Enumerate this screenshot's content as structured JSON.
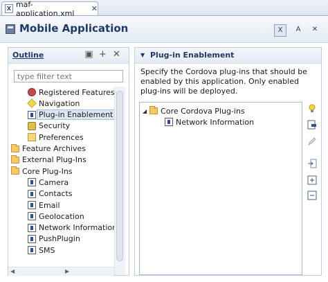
{
  "editor_tab": {
    "label": "maf-application.xml",
    "close": "✕"
  },
  "header": {
    "title": "Mobile Application"
  },
  "header_buttons": [
    {
      "name": "source-view-button",
      "label": "X"
    },
    {
      "name": "bold-view-button",
      "label": "A"
    },
    {
      "name": "clear-button",
      "label": "✕"
    }
  ],
  "outline": {
    "title": "Outline",
    "filter_placeholder": "type filter text",
    "items": [
      {
        "label": "Registered Features",
        "icon": "gear-icon",
        "depth": 1,
        "selected": false
      },
      {
        "label": "Navigation",
        "icon": "navigation-icon",
        "depth": 1,
        "selected": false
      },
      {
        "label": "Plug-in Enablement",
        "icon": "plugin-icon",
        "depth": 1,
        "selected": true
      },
      {
        "label": "Security",
        "icon": "lock-icon",
        "depth": 1,
        "selected": false
      },
      {
        "label": "Preferences",
        "icon": "preferences-icon",
        "depth": 1,
        "selected": false
      },
      {
        "label": "Feature Archives",
        "icon": "folder-icon",
        "depth": 0,
        "selected": false
      },
      {
        "label": "External Plug-Ins",
        "icon": "folder-icon",
        "depth": 0,
        "selected": false
      },
      {
        "label": "Core Plug-Ins",
        "icon": "folder-icon",
        "depth": 0,
        "selected": false
      },
      {
        "label": "Camera",
        "icon": "plugin-icon",
        "depth": 1,
        "selected": false
      },
      {
        "label": "Contacts",
        "icon": "plugin-icon",
        "depth": 1,
        "selected": false
      },
      {
        "label": "Email",
        "icon": "plugin-icon",
        "depth": 1,
        "selected": false
      },
      {
        "label": "Geolocation",
        "icon": "plugin-icon",
        "depth": 1,
        "selected": false
      },
      {
        "label": "Network Information",
        "icon": "plugin-icon",
        "depth": 1,
        "selected": false
      },
      {
        "label": "PushPlugin",
        "icon": "plugin-icon",
        "depth": 1,
        "selected": false
      },
      {
        "label": "SMS",
        "icon": "plugin-icon",
        "depth": 1,
        "selected": false
      }
    ]
  },
  "plugin_section": {
    "title": "Plug-in Enablement",
    "description": "Specify the Cordova plug-ins that should be enabled by this application.  Only enabled plug-ins will be deployed.",
    "tree": [
      {
        "label": "Core Cordova Plug-ins",
        "icon": "folder-icon",
        "expanded": true
      },
      {
        "label": "Network Information",
        "icon": "plugin-icon"
      }
    ]
  },
  "colors": {
    "accent": "#1f3a64",
    "selection": "#dce7f5"
  }
}
